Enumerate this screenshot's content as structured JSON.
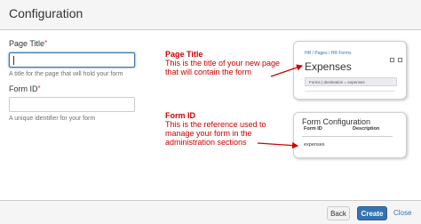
{
  "dialog": {
    "title": "Configuration"
  },
  "form": {
    "page_title": {
      "label": "Page Title",
      "required_mark": "*",
      "value": "",
      "help": "A title for the page that will hold your form"
    },
    "form_id": {
      "label": "Form ID",
      "required_mark": "*",
      "value": "",
      "help": "A unique identifier for your form"
    }
  },
  "annotations": {
    "page_title": {
      "heading": "Page Title",
      "text": "This is the title of your new page that will contain the form"
    },
    "form_id": {
      "heading": "Form ID",
      "text": "This is the reference used to manage your form in the administration sections"
    },
    "color": "#cc0000"
  },
  "preview_page": {
    "breadcrumbs": "HR / Pages / HR Forms",
    "title": "Expenses",
    "forms_bar": "Forms | destination = expenses"
  },
  "preview_config": {
    "title": "Form Configuration",
    "columns": [
      "Form ID",
      "Description"
    ],
    "rows": [
      {
        "form_id": "expenses"
      }
    ]
  },
  "footer": {
    "back_label": "Back",
    "create_label": "Create",
    "close_label": "Close"
  },
  "colors": {
    "primary": "#3572b0",
    "link": "#3b73af",
    "required": "#d04437"
  }
}
